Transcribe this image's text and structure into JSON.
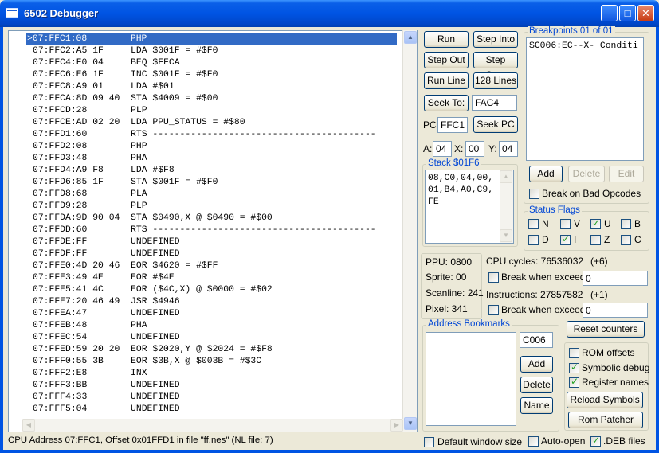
{
  "window": {
    "title": "6502 Debugger"
  },
  "disassembly": {
    "lines": [
      ">07:FFC1:08        PHP",
      "07:FFC2:A5 1F     LDA $001F = #$F0",
      "07:FFC4:F0 04     BEQ $FFCA",
      "07:FFC6:E6 1F     INC $001F = #$F0",
      "07:FFC8:A9 01     LDA #$01",
      "07:FFCA:8D 09 40  STA $4009 = #$00",
      "07:FFCD:28        PLP",
      "07:FFCE:AD 02 20  LDA PPU_STATUS = #$80",
      "07:FFD1:60        RTS -----------------------------------------",
      "07:FFD2:08        PHP",
      "07:FFD3:48        PHA",
      "07:FFD4:A9 F8     LDA #$F8",
      "07:FFD6:85 1F     STA $001F = #$F0",
      "07:FFD8:68        PLA",
      "07:FFD9:28        PLP",
      "07:FFDA:9D 90 04  STA $0490,X @ $0490 = #$00",
      "07:FFDD:60        RTS -----------------------------------------",
      "07:FFDE:FF        UNDEFINED",
      "07:FFDF:FF        UNDEFINED",
      "07:FFE0:4D 20 46  EOR $4620 = #$FF",
      "07:FFE3:49 4E     EOR #$4E",
      "07:FFE5:41 4C     EOR ($4C,X) @ $0000 = #$02",
      "07:FFE7:20 46 49  JSR $4946",
      "07:FFEA:47        UNDEFINED",
      "07:FFEB:48        PHA",
      "07:FFEC:54        UNDEFINED",
      "07:FFED:59 20 20  EOR $2020,Y @ $2024 = #$F8",
      "07:FFF0:55 3B     EOR $3B,X @ $003B = #$3C",
      "07:FFF2:E8        INX",
      "07:FFF3:BB        UNDEFINED",
      "07:FFF4:33        UNDEFINED",
      "07:FFF5:04        UNDEFINED"
    ]
  },
  "status_text": "CPU Address 07:FFC1, Offset 0x01FFD1 in file \"ff.nes\" (NL file: 7)",
  "controls": {
    "run": "Run",
    "step_into": "Step Into",
    "step_out": "Step Out",
    "step_over": "Step Over",
    "run_line": "Run Line",
    "lines_128": "128 Lines",
    "seek_to": "Seek To:",
    "seek_to_value": "FAC4",
    "pc_label": "PC:",
    "pc_value": "FFC1",
    "seek_pc": "Seek PC",
    "a_label": "A:",
    "a_value": "04",
    "x_label": "X:",
    "x_value": "00",
    "y_label": "Y:",
    "y_value": "04"
  },
  "stack": {
    "title": "Stack $01F6",
    "lines": [
      "08,C0,04,00,",
      "01,B4,A0,C9,",
      "FE"
    ]
  },
  "breakpoints": {
    "title": "Breakpoints 01 of 01",
    "item": "$C006:EC--X- Conditi",
    "add": "Add",
    "delete": "Delete",
    "edit": "Edit",
    "break_bad": "Break on Bad Opcodes"
  },
  "status_flags": {
    "title": "Status Flags",
    "flags": [
      {
        "label": "N",
        "checked": false
      },
      {
        "label": "V",
        "checked": false
      },
      {
        "label": "U",
        "checked": true
      },
      {
        "label": "B",
        "checked": false
      },
      {
        "label": "D",
        "checked": false
      },
      {
        "label": "I",
        "checked": true
      },
      {
        "label": "Z",
        "checked": false
      },
      {
        "label": "C",
        "checked": false
      }
    ]
  },
  "ppu": {
    "ppu": "PPU: 0800",
    "sprite": "Sprite: 00",
    "scanline": "Scanline: 241",
    "pixel": "Pixel:  341"
  },
  "cycles": {
    "cpu_label": "CPU cycles: 76536032",
    "cpu_delta": "(+6)",
    "break_exceed": "Break when exceed",
    "cpu_break_value": "0",
    "instr_label": "Instructions: 27857582",
    "instr_delta": "(+1)",
    "instr_break_value": "0"
  },
  "bookmarks": {
    "title": "Address Bookmarks",
    "address": "C006",
    "add": "Add",
    "delete": "Delete",
    "name": "Name"
  },
  "options": {
    "reset_counters": "Reset counters",
    "rom_offsets": "ROM offsets",
    "symbolic_debug": "Symbolic debug",
    "register_names": "Register names",
    "reload_symbols": "Reload Symbols",
    "rom_patcher": "Rom Patcher",
    "rom_offsets_checked": false,
    "symbolic_debug_checked": true,
    "register_names_checked": true
  },
  "bottom": {
    "default_size": "Default window size",
    "auto_open": "Auto-open",
    "deb_files": ".DEB files",
    "default_size_checked": false,
    "auto_open_checked": false,
    "deb_files_checked": true
  }
}
